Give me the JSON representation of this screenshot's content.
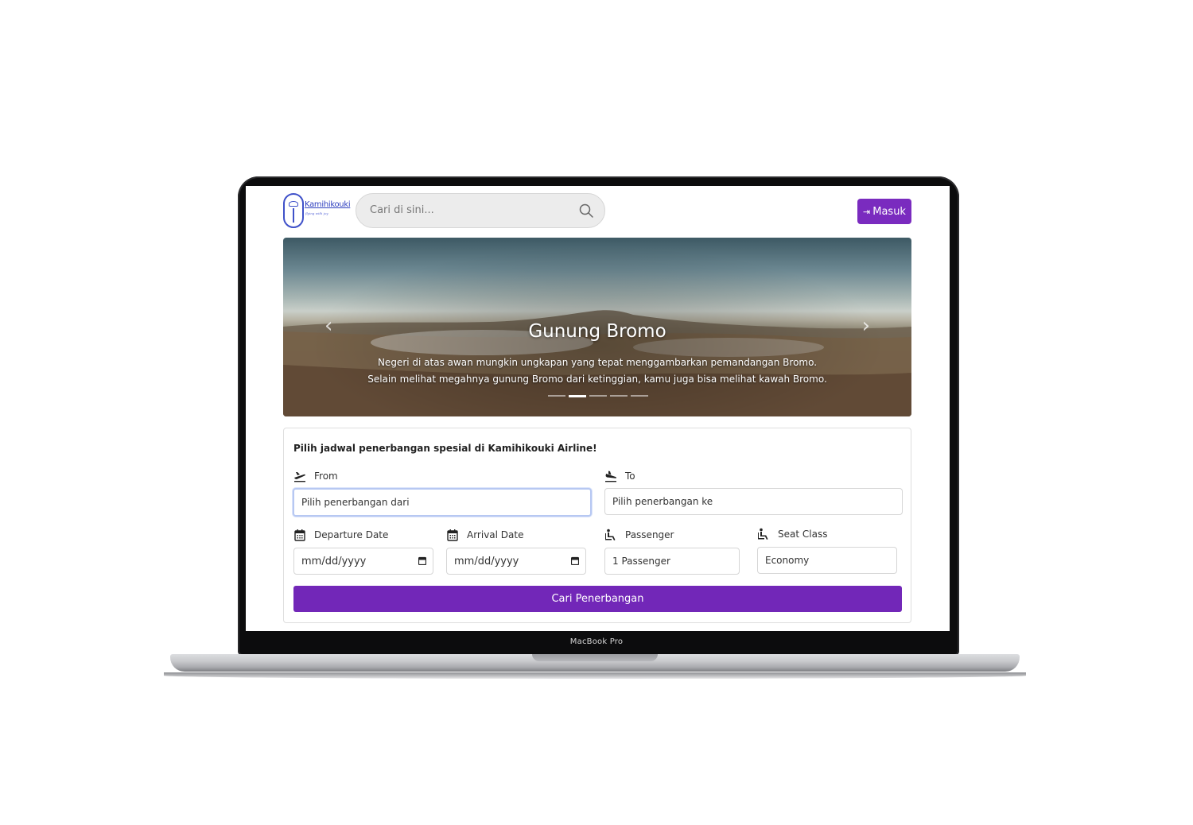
{
  "device": {
    "model_label": "MacBook Pro"
  },
  "navbar": {
    "logo_name": "Kamihikouki",
    "logo_tagline": "flying with joy",
    "search_placeholder": "Cari di sini...",
    "login_label": "Masuk"
  },
  "carousel": {
    "title": "Gunung Bromo",
    "caption_line1": "Negeri di atas awan mungkin ungkapan yang tepat menggambarkan pemandangan Bromo.",
    "caption_line2": "Selain melihat megahnya gunung Bromo dari ketinggian, kamu juga bisa melihat kawah Bromo.",
    "slide_count": 5,
    "active_slide": 2
  },
  "form": {
    "title": "Pilih jadwal penerbangan spesial di Kamihikouki Airline!",
    "from_label": "From",
    "from_value": "Pilih penerbangan dari",
    "to_label": "To",
    "to_value": "Pilih penerbangan ke",
    "departure_label": "Departure Date",
    "departure_value": "mm/dd/yyyy",
    "arrival_label": "Arrival Date",
    "arrival_value": "mm/dd/yyyy",
    "passenger_label": "Passenger",
    "passenger_value": "1 Passenger",
    "seat_label": "Seat Class",
    "seat_value": "Economy",
    "submit_label": "Cari Penerbangan"
  },
  "colors": {
    "accent": "#7227b8",
    "login": "#7a2bbf",
    "logo": "#3f51c9"
  }
}
